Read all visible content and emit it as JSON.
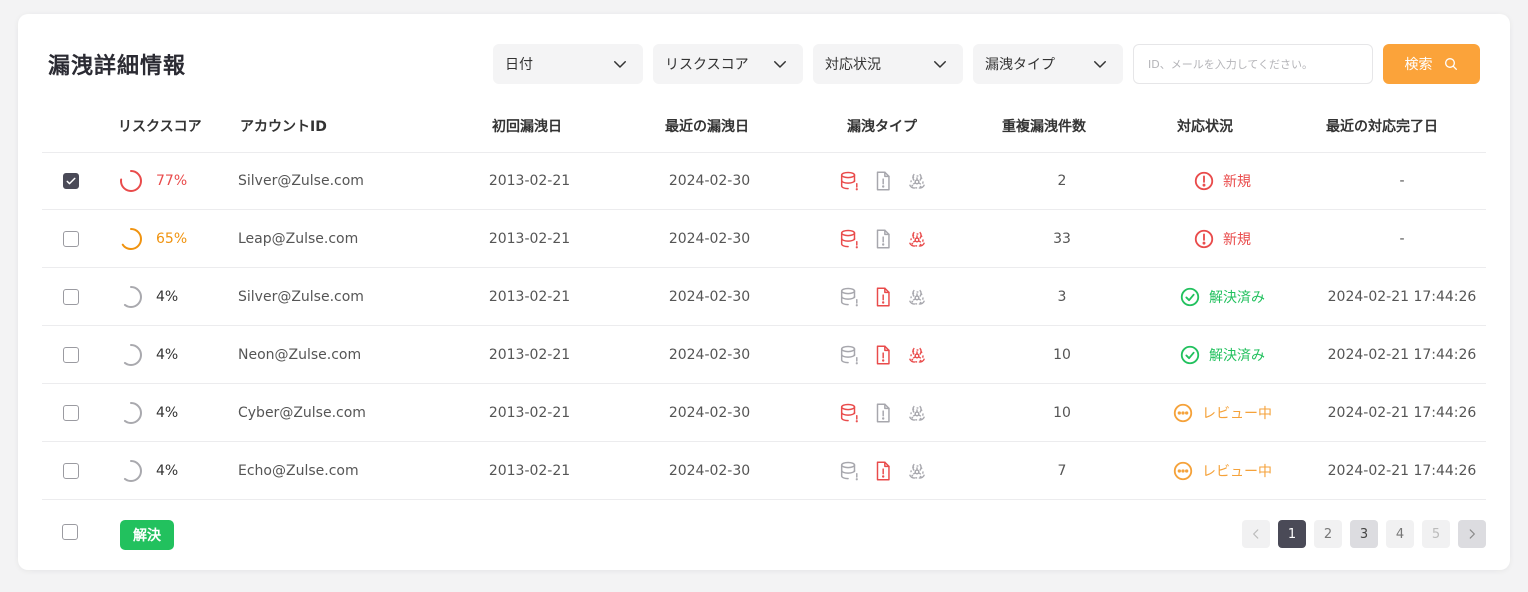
{
  "page_title": "漏洩詳細情報",
  "filters": [
    {
      "label": "日付"
    },
    {
      "label": "リスクスコア"
    },
    {
      "label": "対応状況"
    },
    {
      "label": "漏洩タイプ"
    }
  ],
  "search": {
    "placeholder": "ID、メールを入力してください。",
    "button_label": "検索"
  },
  "columns": {
    "risk": "リスクスコア",
    "account": "アカウントID",
    "first": "初回漏洩日",
    "last": "最近の漏洩日",
    "type": "漏洩タイプ",
    "count": "重複漏洩件数",
    "status": "対応状況",
    "completed": "最近の対応完了日"
  },
  "rows": [
    {
      "checked": true,
      "risk": "77%",
      "risk_value": 0.77,
      "risk_color": "#e94b4b",
      "account": "Silver@Zulse.com",
      "first": "2013-02-21",
      "last": "2024-02-30",
      "types": {
        "db": true,
        "file": false,
        "bio": false
      },
      "count": "2",
      "status": "新規",
      "status_kind": "new",
      "completed": "-"
    },
    {
      "checked": false,
      "risk": "65%",
      "risk_value": 0.65,
      "risk_color": "#f0930f",
      "account": "Leap@Zulse.com",
      "first": "2013-02-21",
      "last": "2024-02-30",
      "types": {
        "db": true,
        "file": false,
        "bio": true
      },
      "count": "33",
      "status": "新規",
      "status_kind": "new",
      "completed": "-"
    },
    {
      "checked": false,
      "risk": "4%",
      "risk_value": 0.04,
      "risk_color": "#333333",
      "account": "Silver@Zulse.com",
      "first": "2013-02-21",
      "last": "2024-02-30",
      "types": {
        "db": false,
        "file": true,
        "bio": false
      },
      "count": "3",
      "status": "解決済み",
      "status_kind": "resolved",
      "completed": "2024-02-21 17:44:26"
    },
    {
      "checked": false,
      "risk": "4%",
      "risk_value": 0.04,
      "risk_color": "#333333",
      "account": "Neon@Zulse.com",
      "first": "2013-02-21",
      "last": "2024-02-30",
      "types": {
        "db": false,
        "file": true,
        "bio": true
      },
      "count": "10",
      "status": "解決済み",
      "status_kind": "resolved",
      "completed": "2024-02-21 17:44:26"
    },
    {
      "checked": false,
      "risk": "4%",
      "risk_value": 0.04,
      "risk_color": "#333333",
      "account": "Cyber@Zulse.com",
      "first": "2013-02-21",
      "last": "2024-02-30",
      "types": {
        "db": true,
        "file": false,
        "bio": false
      },
      "count": "10",
      "status": "レビュー中",
      "status_kind": "review",
      "completed": "2024-02-21 17:44:26"
    },
    {
      "checked": false,
      "risk": "4%",
      "risk_value": 0.04,
      "risk_color": "#333333",
      "account": "Echo@Zulse.com",
      "first": "2013-02-21",
      "last": "2024-02-30",
      "types": {
        "db": false,
        "file": true,
        "bio": false
      },
      "count": "7",
      "status": "レビュー中",
      "status_kind": "review",
      "completed": "2024-02-21 17:44:26"
    }
  ],
  "footer": {
    "resolve_label": "解決"
  },
  "pagination": {
    "pages": [
      "1",
      "2",
      "3",
      "4",
      "5"
    ],
    "current": "1"
  },
  "colors": {
    "accent": "#fba33a",
    "danger": "#e94b4b",
    "resolved": "#22c15e",
    "review": "#f5a23a",
    "inactive_icon": "#a7a7ad"
  }
}
